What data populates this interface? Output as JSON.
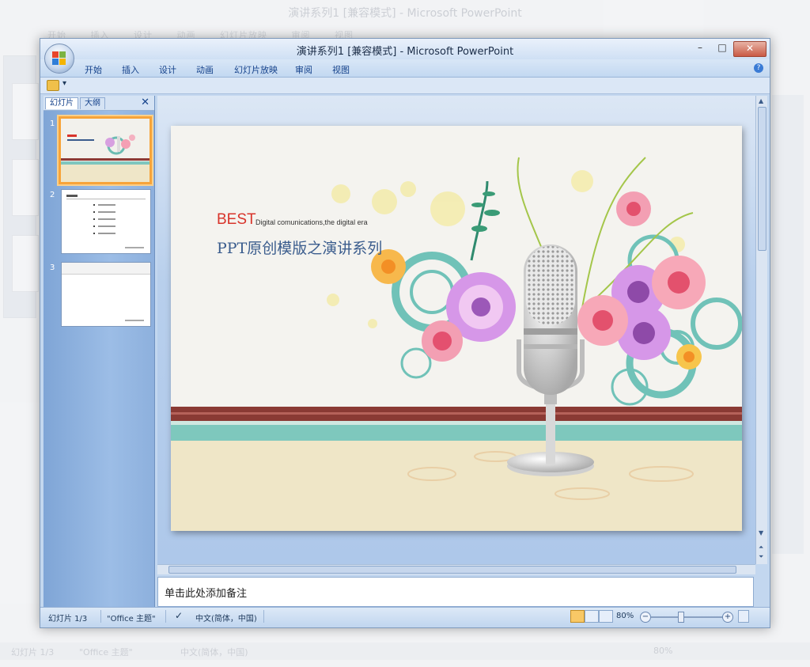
{
  "window": {
    "title": "演讲系列1 [兼容模式] - Microsoft PowerPoint",
    "controls": {
      "minimize": "–",
      "maximize": "□",
      "close": "✕"
    }
  },
  "ribbon": {
    "tabs": [
      "开始",
      "插入",
      "设计",
      "动画",
      "幻灯片放映",
      "审阅",
      "视图"
    ],
    "help": "?"
  },
  "qat": {
    "more": "▾"
  },
  "left_pane": {
    "tabs": {
      "slides": "幻灯片",
      "outline": "大纲"
    },
    "close": "✕",
    "slides": [
      {
        "num": "1",
        "selected": true
      },
      {
        "num": "2",
        "selected": false
      },
      {
        "num": "3",
        "selected": false
      }
    ]
  },
  "slide": {
    "best": "BEST",
    "subtitle": "Digital comunications,the digital era",
    "title_cn": "PPT原创模版之演讲系列"
  },
  "notes": {
    "placeholder": "单击此处添加备注"
  },
  "statusbar": {
    "slide_info": "幻灯片 1/3",
    "theme": "\"Office 主题\"",
    "language": "中文(简体，中国)",
    "zoom": "80%",
    "zoom_minus": "−",
    "zoom_plus": "+"
  },
  "background_window": {
    "title": "演讲系列1 [兼容模式] - Microsoft PowerPoint",
    "tabs": [
      "开始",
      "插入",
      "设计",
      "动画",
      "幻灯片放映",
      "审阅",
      "视图"
    ],
    "status_slide": "幻灯片 1/3",
    "status_theme": "\"Office 主题\"",
    "status_lang": "中文(简体，中国)",
    "status_zoom": "80%"
  },
  "colors": {
    "accent": "#15428b",
    "best_red": "#d8342b",
    "title_blue": "#3a5c8d",
    "selection_orange": "#f7a43a"
  }
}
